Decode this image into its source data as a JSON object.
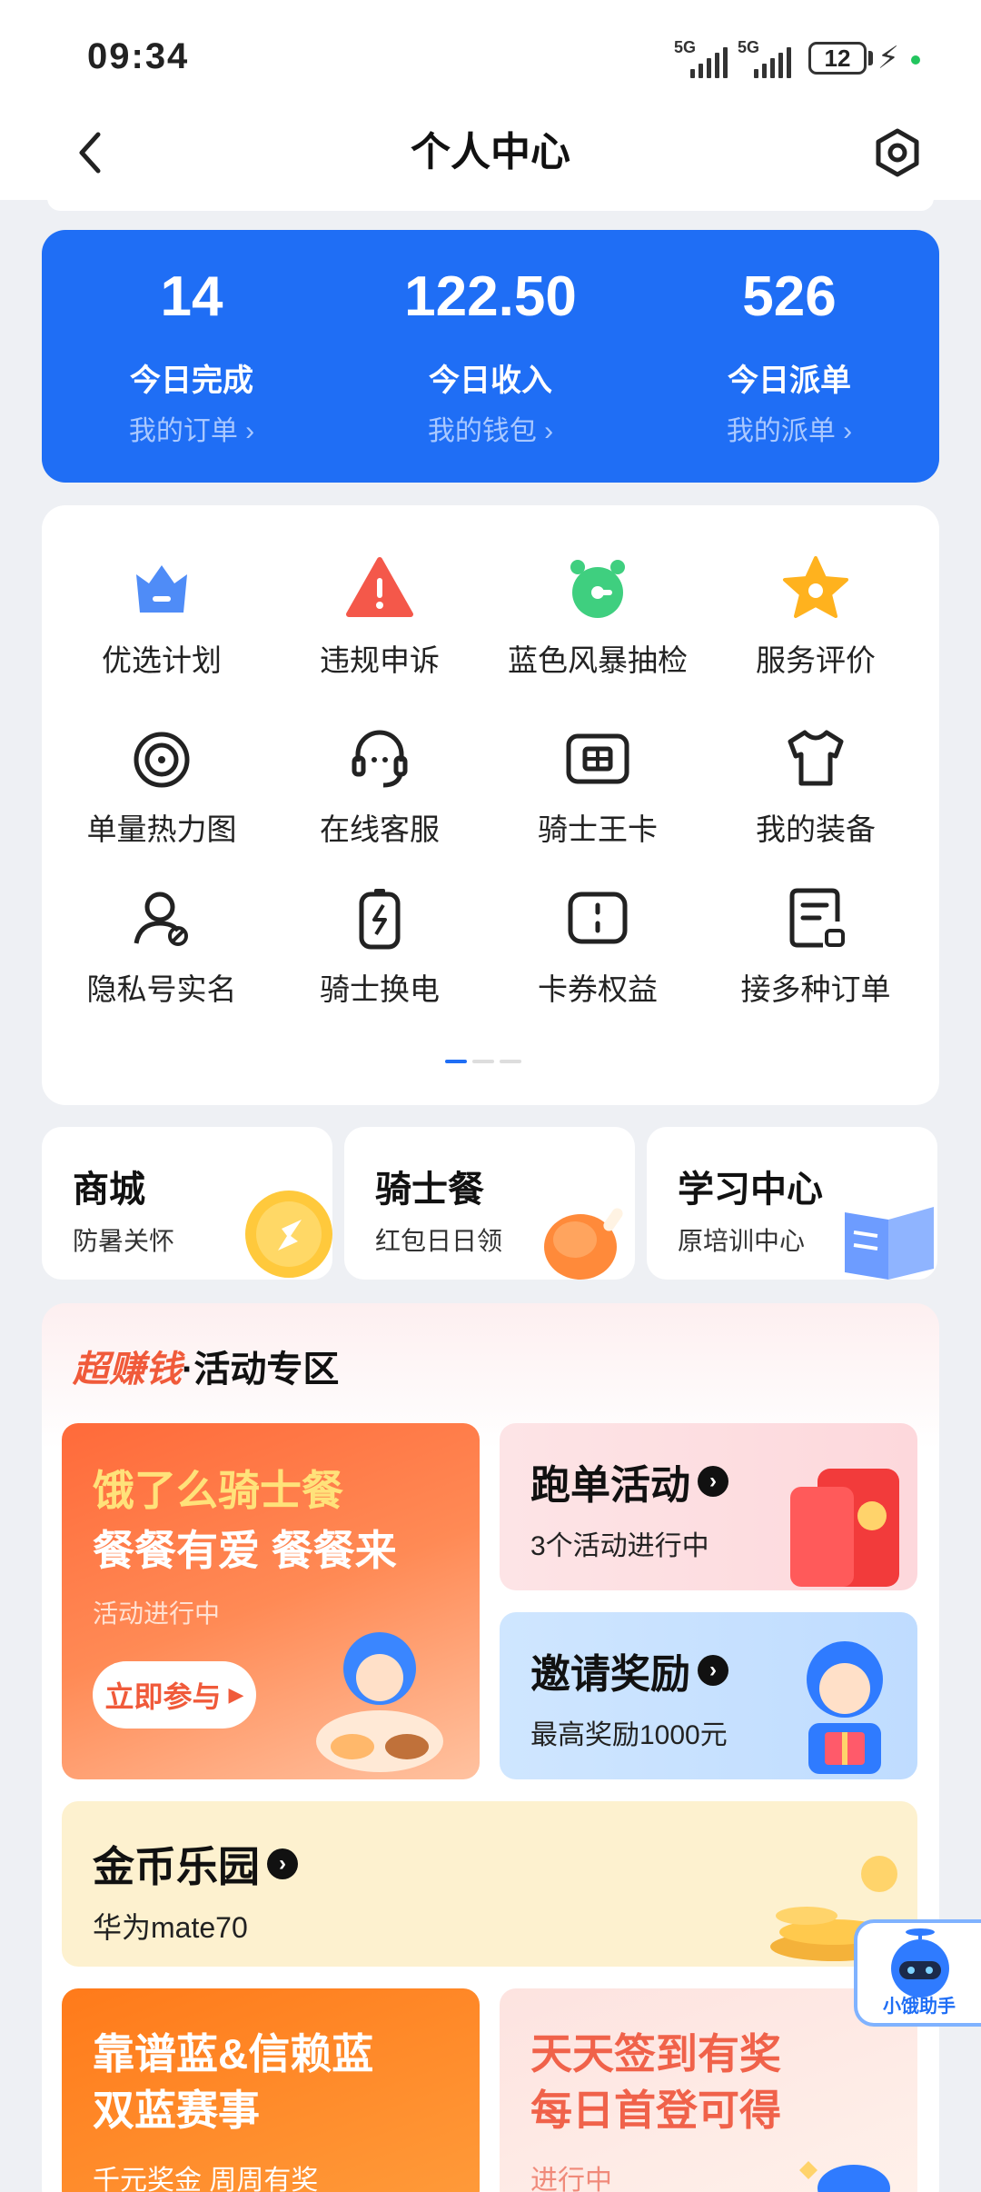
{
  "status_bar": {
    "time": "09:34",
    "net1": "5G",
    "net2": "5G",
    "battery": "12"
  },
  "header": {
    "title": "个人中心"
  },
  "stats": [
    {
      "value": "14",
      "label": "今日完成",
      "link": "我的订单 ›"
    },
    {
      "value": "122.50",
      "label": "今日收入",
      "link": "我的钱包 ›"
    },
    {
      "value": "526",
      "label": "今日派单",
      "link": "我的派单 ›"
    }
  ],
  "grid": [
    {
      "label": "优选计划",
      "icon": "crown-icon"
    },
    {
      "label": "违规申诉",
      "icon": "warning-icon"
    },
    {
      "label": "蓝色风暴抽检",
      "icon": "alarm-clock-icon"
    },
    {
      "label": "服务评价",
      "icon": "star-icon"
    },
    {
      "label": "单量热力图",
      "icon": "heatmap-icon"
    },
    {
      "label": "在线客服",
      "icon": "headset-icon"
    },
    {
      "label": "骑士王卡",
      "icon": "sim-card-icon"
    },
    {
      "label": "我的装备",
      "icon": "tshirt-icon"
    },
    {
      "label": "隐私号实名",
      "icon": "user-privacy-icon"
    },
    {
      "label": "骑士换电",
      "icon": "battery-swap-icon"
    },
    {
      "label": "卡券权益",
      "icon": "coupon-icon"
    },
    {
      "label": "接多种订单",
      "icon": "order-doc-icon"
    }
  ],
  "mini_cards": [
    {
      "title": "商城",
      "sub": "防暑关怀"
    },
    {
      "title": "骑士餐",
      "sub": "红包日日领"
    },
    {
      "title": "学习中心",
      "sub": "原培训中心"
    }
  ],
  "activity": {
    "head_hot": "超赚钱",
    "head_rest": "·活动专区",
    "feature": {
      "line1": "饿了么骑士餐",
      "line2": "餐餐有爱 餐餐来",
      "status": "活动进行中",
      "button": "立即参与"
    },
    "run": {
      "title": "跑单活动",
      "sub": "3个活动进行中"
    },
    "invite": {
      "title": "邀请奖励",
      "sub": "最高奖励1000元"
    },
    "gold": {
      "title": "金币乐园",
      "sub": "华为mate70"
    },
    "contest": {
      "line1": "靠谱蓝&信赖蓝",
      "line2": "双蓝赛事",
      "sub": "千元奖金 周周有奖"
    },
    "signin": {
      "line1": "天天签到有奖",
      "line2": "每日首登可得",
      "sub": "进行中"
    }
  },
  "helper": {
    "label": "小饿助手"
  },
  "colors": {
    "primary": "#1f6ef5",
    "accent": "#f05a3a"
  }
}
